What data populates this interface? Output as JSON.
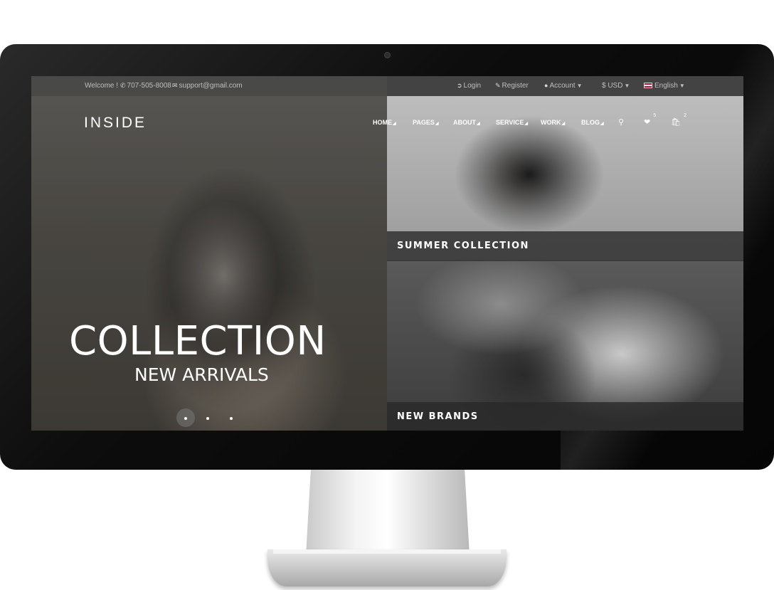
{
  "topbar": {
    "welcome": "Welcome !",
    "phone": "707-505-8008",
    "email": "support@gmail.com",
    "login": "Login",
    "register": "Register",
    "account": "Account",
    "currency": "$ USD",
    "language": "English"
  },
  "header": {
    "logo": "INSIDE",
    "nav": [
      "HOME",
      "PAGES",
      "ABOUT",
      "SERVICE",
      "WORK",
      "BLOG"
    ],
    "wishlist_count": "5",
    "cart_count": "2"
  },
  "hero": {
    "title": "COLLECTION",
    "subtitle": "NEW ARRIVALS",
    "slides": 3,
    "active_slide": 1
  },
  "panels": {
    "top_caption": "SUMMER COLLECTION",
    "bottom_caption": "NEW BRANDS"
  },
  "icons": {
    "phone": "phone-icon",
    "email": "envelope-icon",
    "login": "sign-in-icon",
    "register": "pencil-icon",
    "account": "user-icon",
    "search": "search-icon",
    "wishlist": "heart-icon",
    "cart": "shopping-bag-icon"
  }
}
